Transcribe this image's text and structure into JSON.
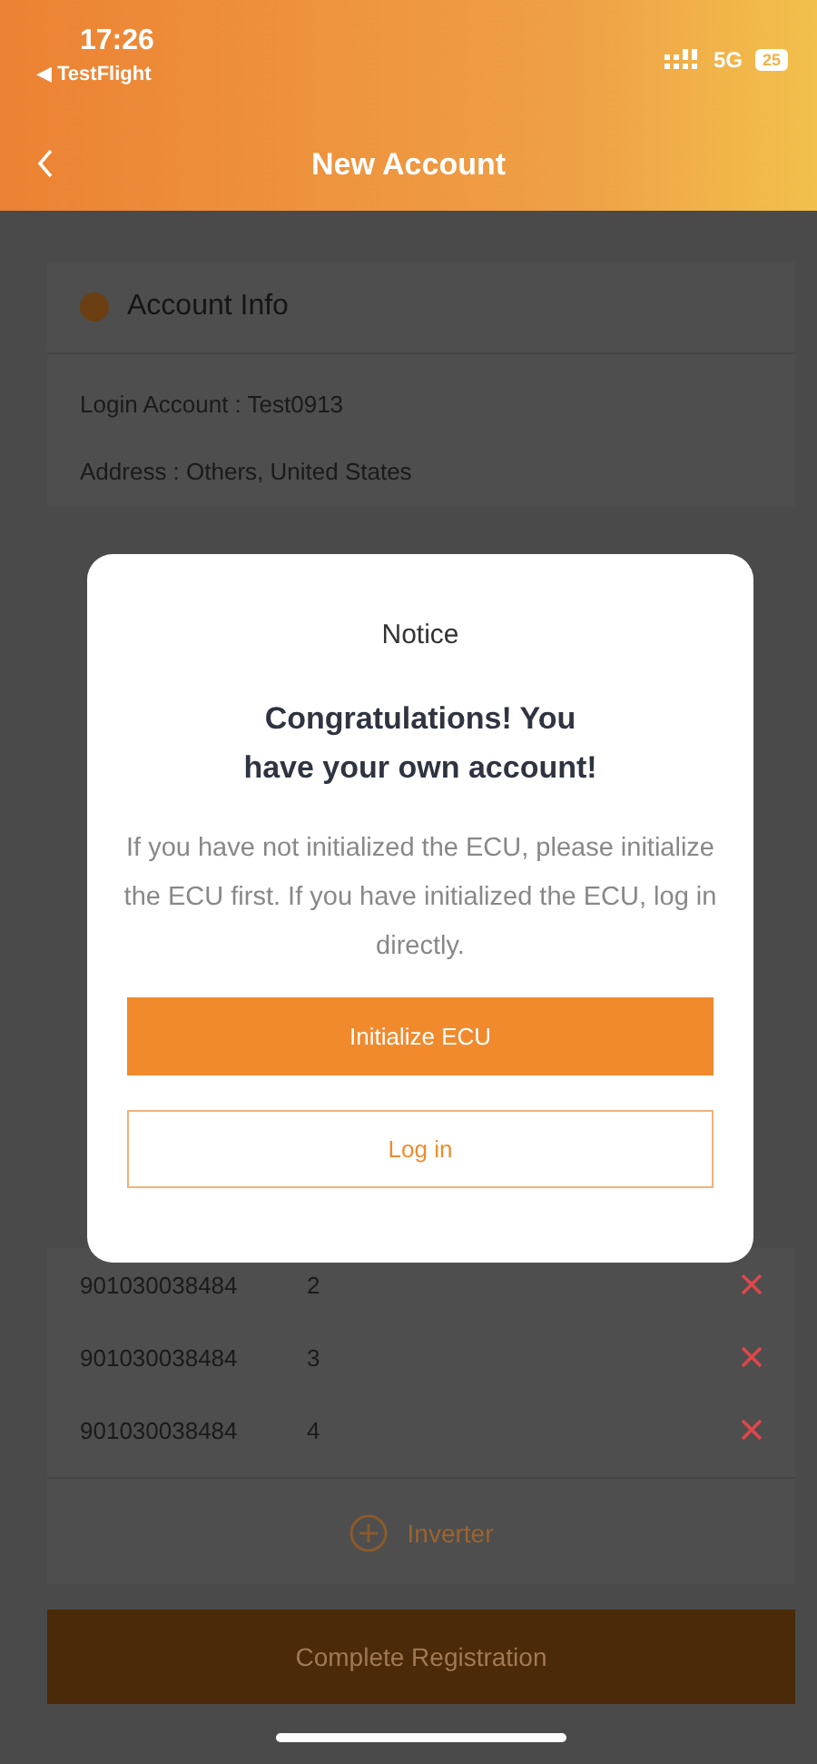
{
  "status_bar": {
    "time": "17:26",
    "back_app": "◀ TestFlight",
    "network": "5G",
    "battery": "25"
  },
  "nav": {
    "title": "New Account"
  },
  "account_info": {
    "title": "Account Info",
    "lines": [
      "Login Account : Test0913",
      "Address : Others, United States"
    ]
  },
  "devices": [
    {
      "serial": "901030038484",
      "number": "2"
    },
    {
      "serial": "901030038484",
      "number": "3"
    },
    {
      "serial": "901030038484",
      "number": "4"
    }
  ],
  "add_button": {
    "label": "Inverter"
  },
  "complete_button": {
    "label": "Complete Registration"
  },
  "dialog": {
    "title": "Notice",
    "heading": "Congratulations! You have your own account!",
    "message": "If you have not initialized the ECU, please initialize the ECU first. If you have initialized the ECU, log in directly.",
    "buttons": [
      {
        "kind": "primary",
        "label": "Initialize ECU"
      },
      {
        "kind": "outline",
        "label": "Log in"
      }
    ]
  }
}
